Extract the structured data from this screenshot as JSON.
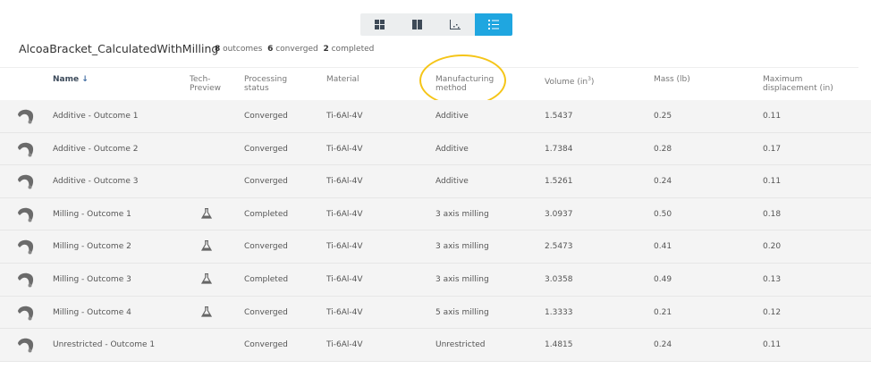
{
  "toolbar": {
    "views": [
      {
        "icon": "grid-icon",
        "active": false
      },
      {
        "icon": "columns-icon",
        "active": false
      },
      {
        "icon": "scatter-icon",
        "active": false
      },
      {
        "icon": "list-icon",
        "active": true
      }
    ]
  },
  "title": "AlcoaBracket_CalculatedWithMilling",
  "stats": {
    "outcomes_n": "8",
    "outcomes_l": "outcomes",
    "converged_n": "6",
    "converged_l": "converged",
    "completed_n": "2",
    "completed_l": "completed"
  },
  "columns": {
    "name": "Name",
    "tech1": "Tech-",
    "tech2": "Preview",
    "status1": "Processing",
    "status2": "status",
    "material": "Material",
    "method1": "Manufacturing",
    "method2": "method",
    "volume": "Volume (in",
    "volume_sup": "3",
    "volume_end": ")",
    "mass": "Mass (lb)",
    "disp1": "Maximum",
    "disp2": "displacement (in)"
  },
  "rows": [
    {
      "name": "Additive - Outcome 1",
      "tech": false,
      "status": "Converged",
      "material": "Ti-6Al-4V",
      "method": "Additive",
      "volume": "1.5437",
      "mass": "0.25",
      "disp": "0.11"
    },
    {
      "name": "Additive - Outcome 2",
      "tech": false,
      "status": "Converged",
      "material": "Ti-6Al-4V",
      "method": "Additive",
      "volume": "1.7384",
      "mass": "0.28",
      "disp": "0.17"
    },
    {
      "name": "Additive - Outcome 3",
      "tech": false,
      "status": "Converged",
      "material": "Ti-6Al-4V",
      "method": "Additive",
      "volume": "1.5261",
      "mass": "0.24",
      "disp": "0.11"
    },
    {
      "name": "Milling - Outcome 1",
      "tech": true,
      "status": "Completed",
      "material": "Ti-6Al-4V",
      "method": "3 axis milling",
      "volume": "3.0937",
      "mass": "0.50",
      "disp": "0.18"
    },
    {
      "name": "Milling - Outcome 2",
      "tech": true,
      "status": "Converged",
      "material": "Ti-6Al-4V",
      "method": "3 axis milling",
      "volume": "2.5473",
      "mass": "0.41",
      "disp": "0.20"
    },
    {
      "name": "Milling - Outcome 3",
      "tech": true,
      "status": "Completed",
      "material": "Ti-6Al-4V",
      "method": "3 axis milling",
      "volume": "3.0358",
      "mass": "0.49",
      "disp": "0.13"
    },
    {
      "name": "Milling - Outcome 4",
      "tech": true,
      "status": "Converged",
      "material": "Ti-6Al-4V",
      "method": "5 axis milling",
      "volume": "1.3333",
      "mass": "0.21",
      "disp": "0.12"
    },
    {
      "name": "Unrestricted - Outcome 1",
      "tech": false,
      "status": "Converged",
      "material": "Ti-6Al-4V",
      "method": "Unrestricted",
      "volume": "1.4815",
      "mass": "0.24",
      "disp": "0.11"
    }
  ]
}
